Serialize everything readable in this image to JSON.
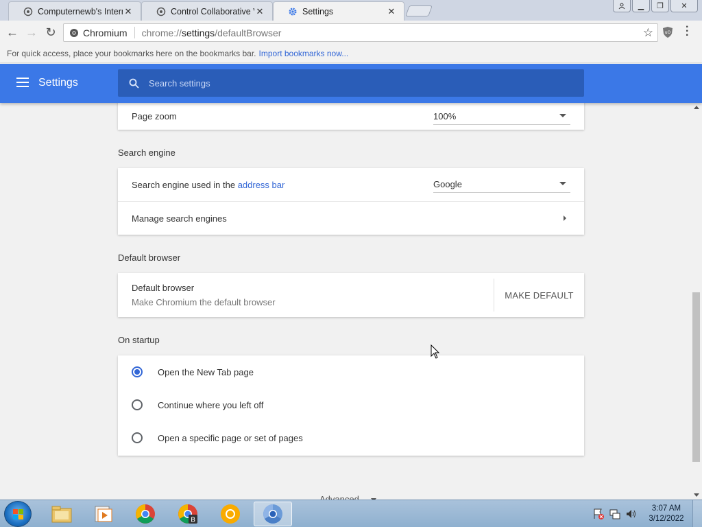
{
  "tabs": [
    {
      "label": "Computernewb's Internet"
    },
    {
      "label": "Control Collaborative Vir"
    },
    {
      "label": "Settings"
    }
  ],
  "toolbar": {
    "site_chip": "Chromium",
    "url_scheme": "chrome://",
    "url_host": "settings",
    "url_path": "/defaultBrowser"
  },
  "bookmarks": {
    "hint": "For quick access, place your bookmarks here on the bookmarks bar.",
    "import_link": "Import bookmarks now..."
  },
  "header": {
    "title": "Settings",
    "search_placeholder": "Search settings"
  },
  "appearance": {
    "page_zoom_label": "Page zoom",
    "page_zoom_value": "100%"
  },
  "search_engine": {
    "section_title": "Search engine",
    "used_label_prefix": "Search engine used in the",
    "used_label_link": "address bar",
    "engine_value": "Google",
    "manage_label": "Manage search engines"
  },
  "default_browser": {
    "section_title": "Default browser",
    "title": "Default browser",
    "subtitle": "Make Chromium the default browser",
    "button": "MAKE DEFAULT"
  },
  "startup": {
    "section_title": "On startup",
    "options": [
      {
        "label": "Open the New Tab page",
        "checked": true
      },
      {
        "label": "Continue where you left off",
        "checked": false
      },
      {
        "label": "Open a specific page or set of pages",
        "checked": false
      }
    ]
  },
  "advanced_label": "Advanced",
  "taskbar": {
    "time": "3:07 AM",
    "date": "3/12/2022"
  },
  "colors": {
    "header_blue": "#3b78e7",
    "accent": "#3367d6"
  }
}
